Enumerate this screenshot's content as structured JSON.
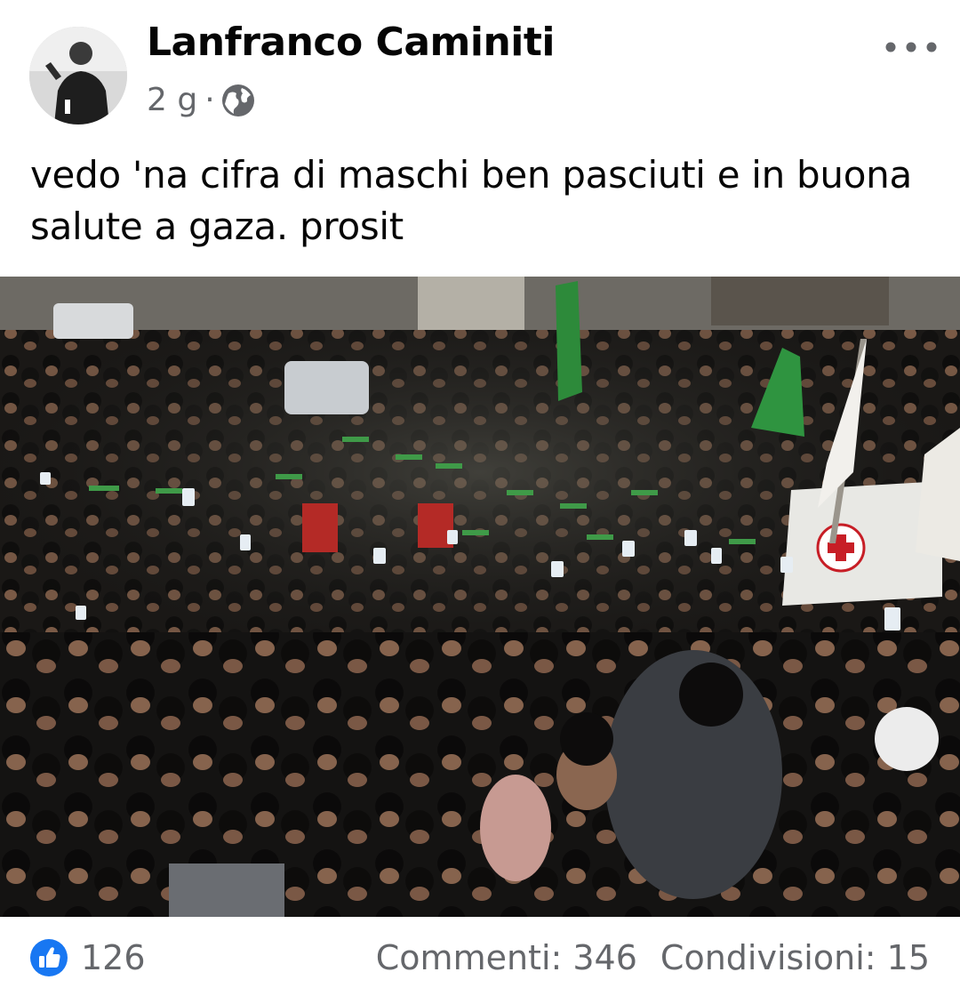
{
  "post": {
    "author": "Lanfranco Caminiti",
    "time": "2 g",
    "separator": "·",
    "privacy_icon": "globe-icon",
    "text": "vedo 'na cifra di maschi ben pasciuti e in buona salute a gaza. prosit"
  },
  "footer": {
    "like_count": "126",
    "comments": "Commenti: 346",
    "shares": "Condivisioni: 15"
  },
  "colors": {
    "like_blue": "#1877f2",
    "secondary_text": "#65676b"
  }
}
